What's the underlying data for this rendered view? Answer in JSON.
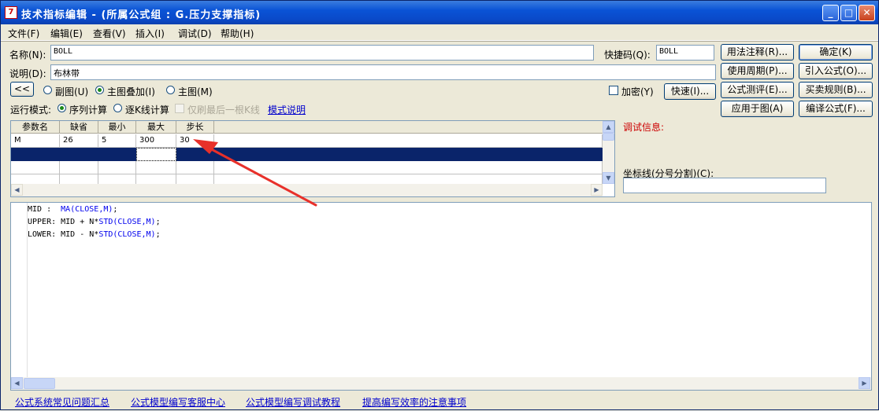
{
  "window": {
    "title": "技术指标编辑 - (所属公式组 : G.压力支撑指标)",
    "icon_name": "formula-app-icon",
    "icon_glyph": "7",
    "minimize_glyph": "_",
    "maximize_glyph": "□",
    "close_glyph": "✕"
  },
  "menu": [
    "文件(F)",
    "编辑(E)",
    "查看(V)",
    "插入(I)",
    "调试(D)",
    "帮助(H)"
  ],
  "form": {
    "name_label": "名称(N):",
    "name_value": "BOLL",
    "shortcut_label": "快捷码(Q):",
    "shortcut_value": "BOLL",
    "desc_label": "说明(D):",
    "desc_value": "布林带",
    "collapse_button": "<<",
    "chart_options": [
      {
        "label": "副图(U)",
        "checked": false
      },
      {
        "label": "主图叠加(I)",
        "checked": true
      },
      {
        "label": "主图(M)",
        "checked": false
      }
    ],
    "encrypt_label": "加密(Y)",
    "quick_button": "快速(I)...",
    "run_mode_label": "运行模式:",
    "run_mode_options": [
      {
        "label": "序列计算",
        "checked": true
      },
      {
        "label": "逐K线计算",
        "checked": false
      }
    ],
    "last_bar_only_label": "仅刷最后一根K线",
    "mode_help_link": "模式说明"
  },
  "right_buttons": [
    {
      "label": "用法注释(R)...",
      "default": false
    },
    {
      "label": "确定(K)",
      "default": true
    },
    {
      "label": "使用周期(P)...",
      "default": false
    },
    {
      "label": "引入公式(O)...",
      "default": false
    },
    {
      "label": "公式测评(E)...",
      "default": false
    },
    {
      "label": "买卖规则(B)...",
      "default": false
    },
    {
      "label": "应用于图(A)",
      "default": false
    },
    {
      "label": "编译公式(F)...",
      "default": false
    }
  ],
  "params_table": {
    "columns": [
      "参数名",
      "缺省",
      "最小",
      "最大",
      "步长"
    ],
    "rows": [
      [
        "M",
        "26",
        "5",
        "300",
        "30"
      ],
      [
        "",
        "",
        "",
        "",
        ""
      ],
      [
        "",
        "",
        "",
        "",
        ""
      ],
      [
        "",
        "",
        "",
        "",
        ""
      ]
    ],
    "selected_row": 1
  },
  "debug": {
    "label": "调试信息:",
    "axis_label": "坐标线(分号分割)(C):",
    "axis_value": ""
  },
  "code": [
    [
      {
        "t": "MID :  ",
        "fn": false
      },
      {
        "t": "MA(CLOSE,M)",
        "fn": true
      },
      {
        "t": ";",
        "fn": false
      }
    ],
    [
      {
        "t": "UPPER: MID + N*",
        "fn": false
      },
      {
        "t": "STD(CLOSE,M)",
        "fn": true
      },
      {
        "t": ";",
        "fn": false
      }
    ],
    [
      {
        "t": "LOWER: MID - N*",
        "fn": false
      },
      {
        "t": "STD(CLOSE,M)",
        "fn": true
      },
      {
        "t": ";",
        "fn": false
      }
    ]
  ],
  "footer_links": [
    "公式系统常见问题汇总",
    "公式模型编写客服中心",
    "公式模型编写调试教程",
    "提高编写效率的注意事项"
  ],
  "annotation": {
    "color": "#e8302a"
  },
  "colors": {
    "title_bar": "#0a53d6",
    "link": "#0000cc",
    "debug_label": "#cc0000",
    "selection": "#0a246a"
  }
}
